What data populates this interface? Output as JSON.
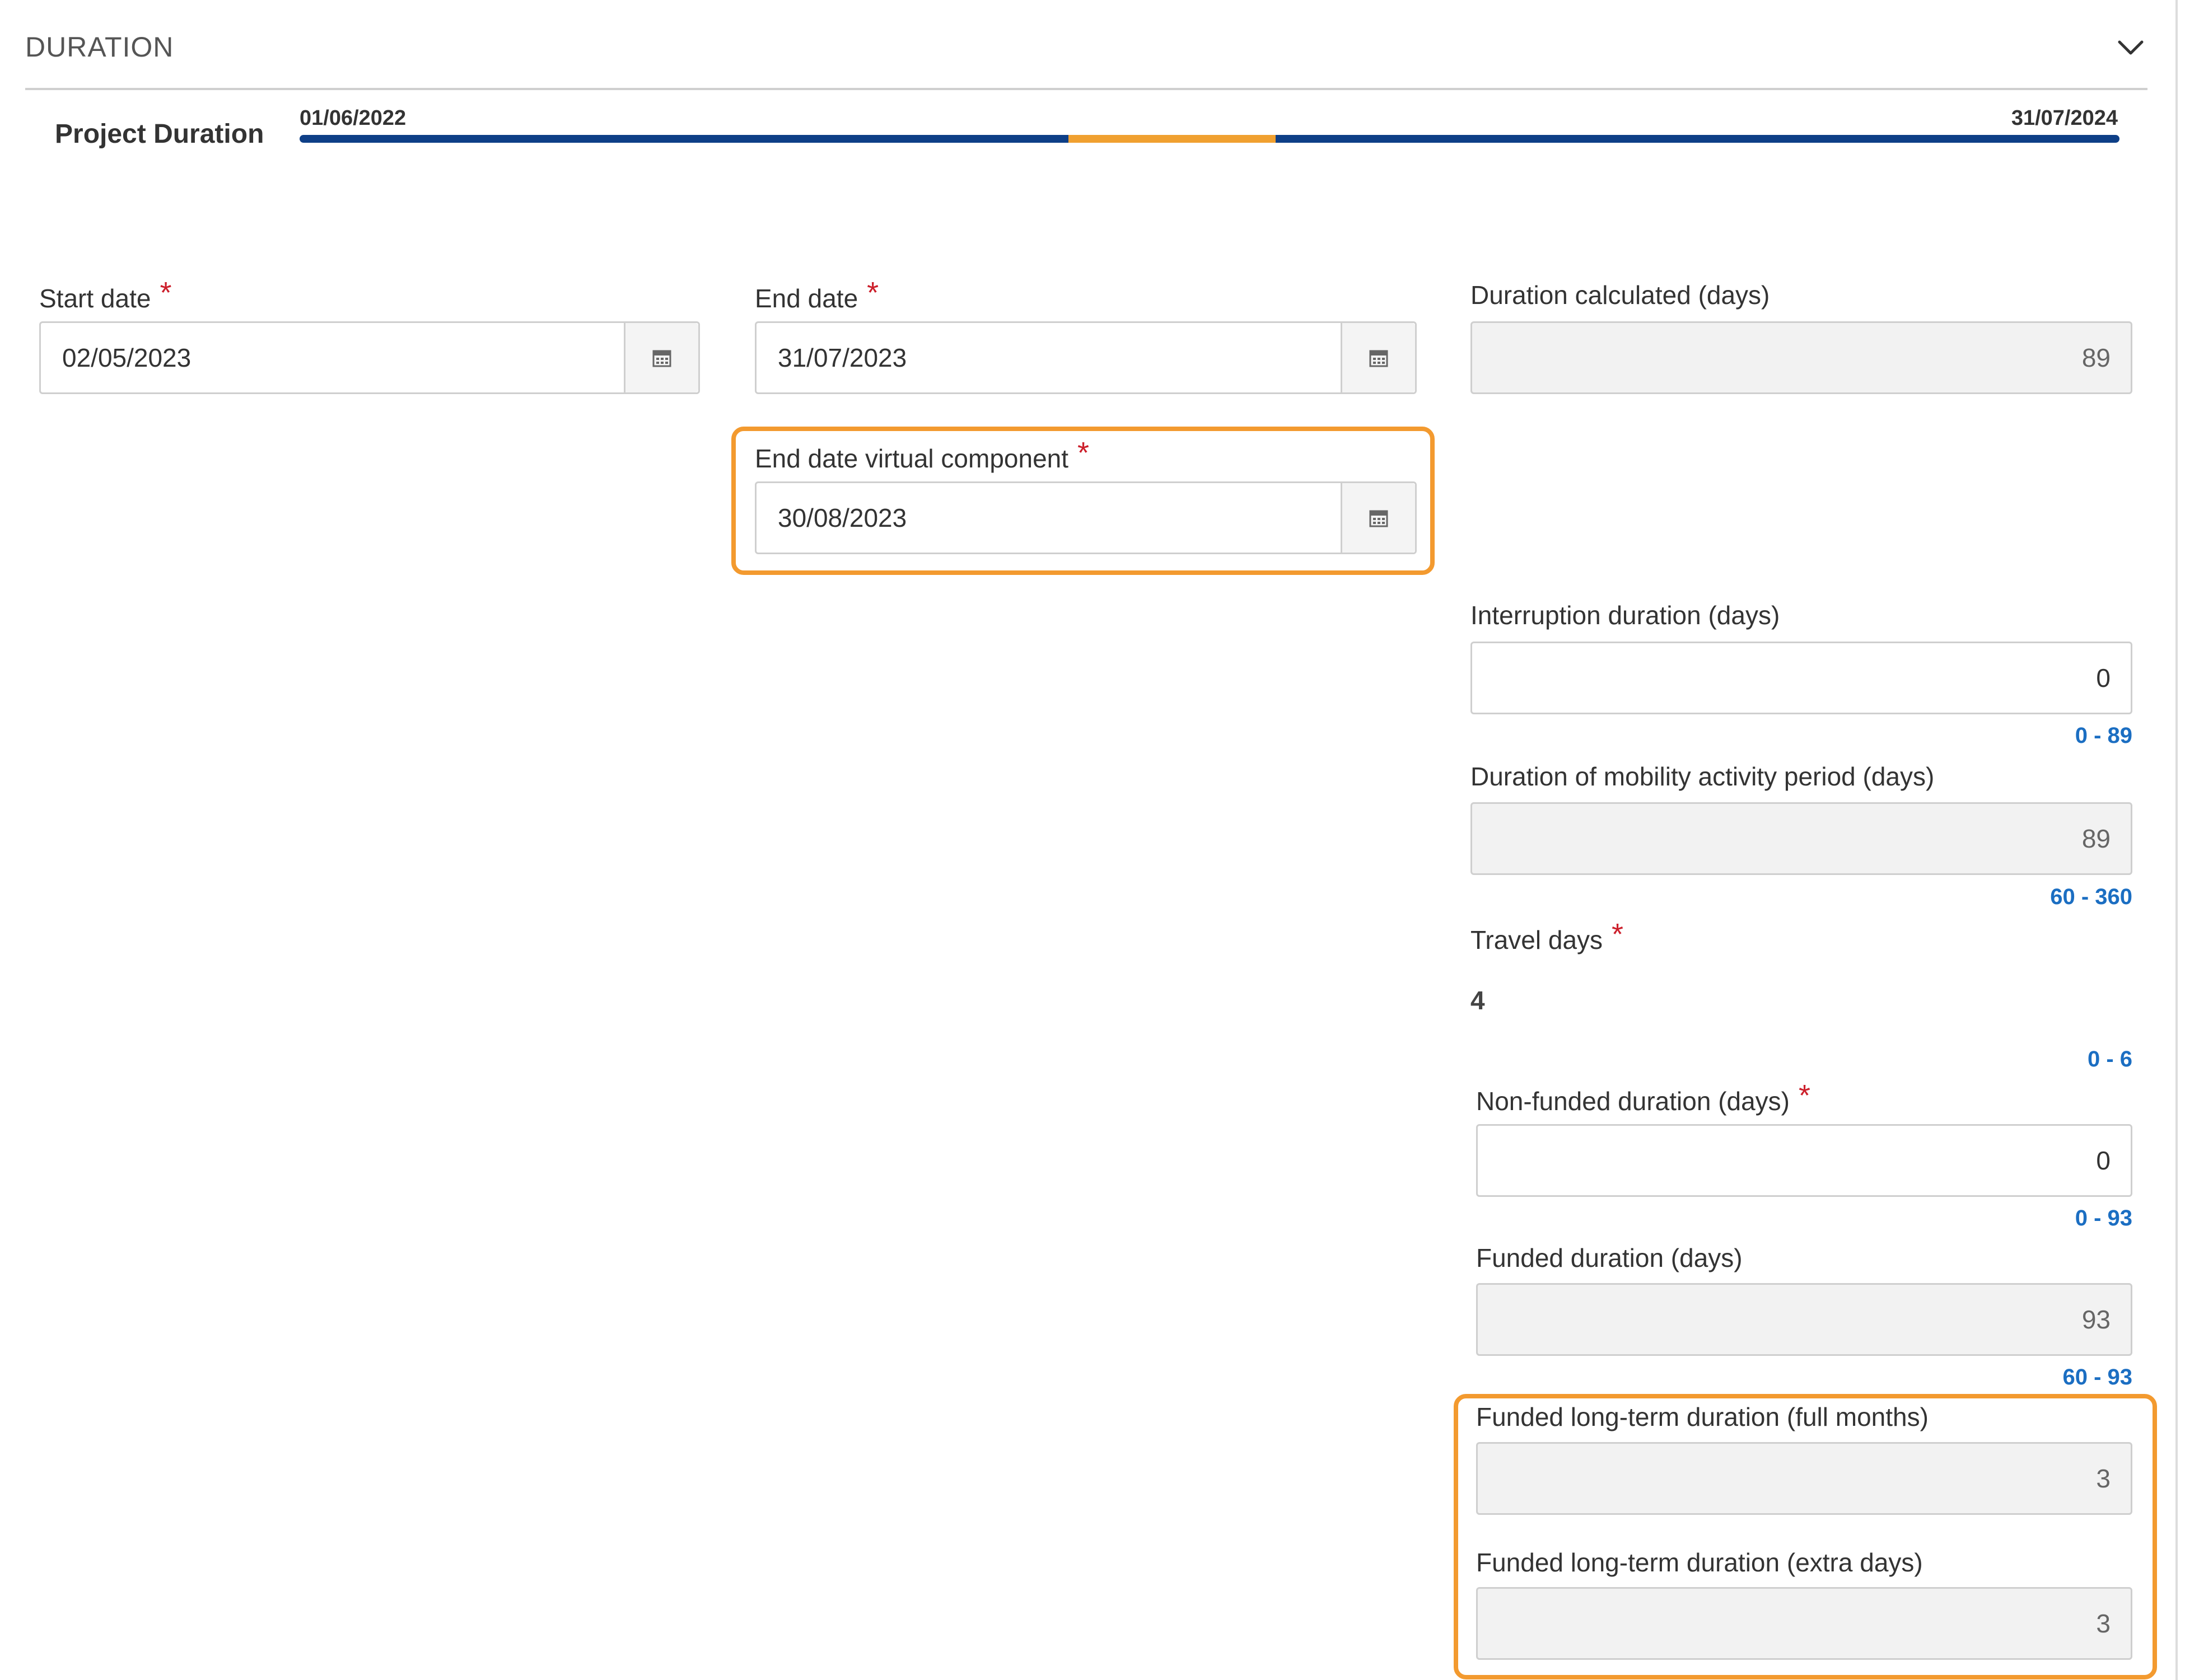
{
  "section": {
    "title": "DURATION",
    "toggle_icon": "chevron-down-icon"
  },
  "project_duration": {
    "label": "Project Duration",
    "start": "01/06/2022",
    "end": "31/07/2024",
    "bar_color": "#0e3f87",
    "highlight_color": "#f0a030"
  },
  "fields": {
    "start_date": {
      "label": "Start date",
      "value": "02/05/2023",
      "required": "*",
      "icon": "calendar-icon"
    },
    "end_date": {
      "label": "End date",
      "value": "31/07/2023",
      "required": "*",
      "icon": "calendar-icon"
    },
    "duration_calculated": {
      "label": "Duration calculated (days)",
      "value": "89"
    },
    "end_date_virtual": {
      "label": "End date virtual component",
      "value": "30/08/2023",
      "required": "*",
      "icon": "calendar-icon"
    },
    "interruption_duration": {
      "label": "Interruption duration (days)",
      "value": "0",
      "range": "0 - 89"
    },
    "mobility_duration": {
      "label": "Duration of mobility activity period (days)",
      "value": "89",
      "range": "60 - 360"
    },
    "travel_days": {
      "label": "Travel days",
      "value": "4",
      "required": "*",
      "range": "0 - 6"
    },
    "non_funded_duration": {
      "label": "Non-funded duration (days)",
      "value": "0",
      "required": "*",
      "range": "0 - 93"
    },
    "funded_duration": {
      "label": "Funded duration (days)",
      "value": "93",
      "range": "60 - 93"
    },
    "funded_long_term_months": {
      "label": "Funded long-term duration (full months)",
      "value": "3"
    },
    "funded_long_term_extra_days": {
      "label": "Funded long-term duration (extra days)",
      "value": "3"
    }
  },
  "colors": {
    "required": "#cc1f2b",
    "range_text": "#1b6ec2",
    "highlight_border": "#f39a2f"
  }
}
